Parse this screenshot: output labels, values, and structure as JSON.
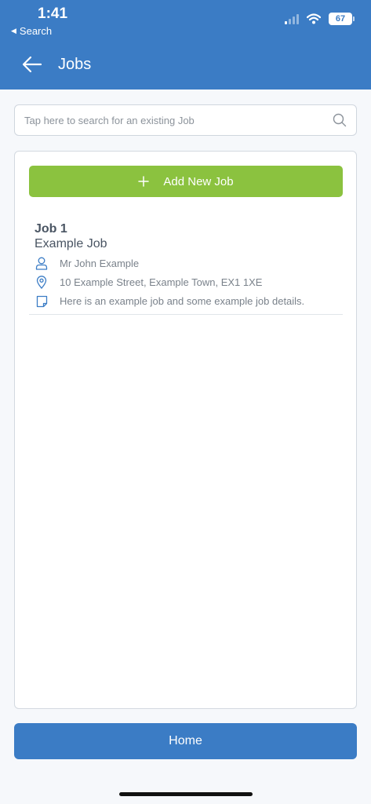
{
  "status_bar": {
    "time": "1:41",
    "back_app_label": "Search",
    "battery": "67"
  },
  "nav": {
    "title": "Jobs"
  },
  "search": {
    "placeholder": "Tap here to search for an existing Job"
  },
  "actions": {
    "add_job_label": "Add New Job",
    "home_label": "Home"
  },
  "jobs": [
    {
      "number": "Job 1",
      "name": "Example Job",
      "contact": "Mr John Example",
      "address": "10 Example Street, Example Town, EX1 1XE",
      "details": "Here is an example job and some example job details."
    }
  ],
  "colors": {
    "primary": "#3b7cc5",
    "accent_green": "#8bc23f",
    "background": "#f6f8fb"
  },
  "icons": {
    "back": "arrow-left-icon",
    "search": "search-icon",
    "add": "plus-icon",
    "contact": "person-icon",
    "address": "location-pin-icon",
    "details": "note-icon"
  }
}
